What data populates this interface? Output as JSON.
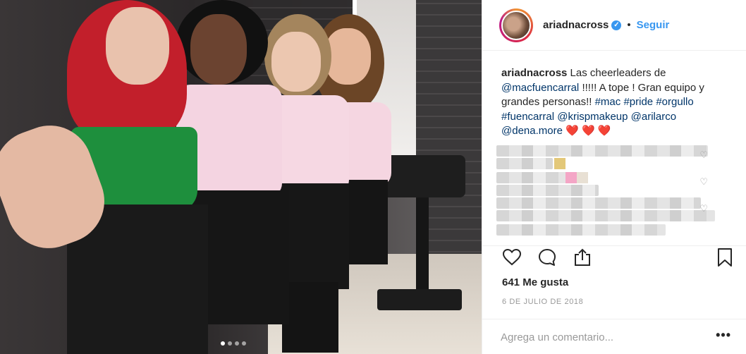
{
  "post": {
    "username": "ariadnacross",
    "verified_glyph": "✓",
    "separator": "•",
    "follow_label": "Seguir",
    "caption": {
      "user": "ariadnacross",
      "text_1": " Las cheerleaders de ",
      "mention_1": "@macfuencarral",
      "text_2": " !!!!! A tope ! Gran equipo y grandes personas!! ",
      "tag_1": "#mac",
      "tag_2": "#pride",
      "tag_3": "#orgullo",
      "tag_4": "#fuencarral",
      "mention_2": "@krispmakeup",
      "mention_3": "@arilarco",
      "mention_4": "@dena.more",
      "hearts": "❤️ ❤️ ❤️"
    },
    "likes": "641 Me gusta",
    "date": "6 DE JULIO DE 2018",
    "comment_placeholder": "Agrega un comentario...",
    "more_label": "•••",
    "carousel": {
      "count": 4,
      "active": 0
    }
  },
  "icons": {
    "like": "heart-outline-icon",
    "comment": "comment-bubble-icon",
    "share": "share-upload-icon",
    "save": "bookmark-icon",
    "small_like": "♡"
  },
  "colors": {
    "link": "#003569",
    "accent": "#3897f0",
    "text": "#262626",
    "muted": "#999999",
    "heart": "#ed1c24"
  }
}
